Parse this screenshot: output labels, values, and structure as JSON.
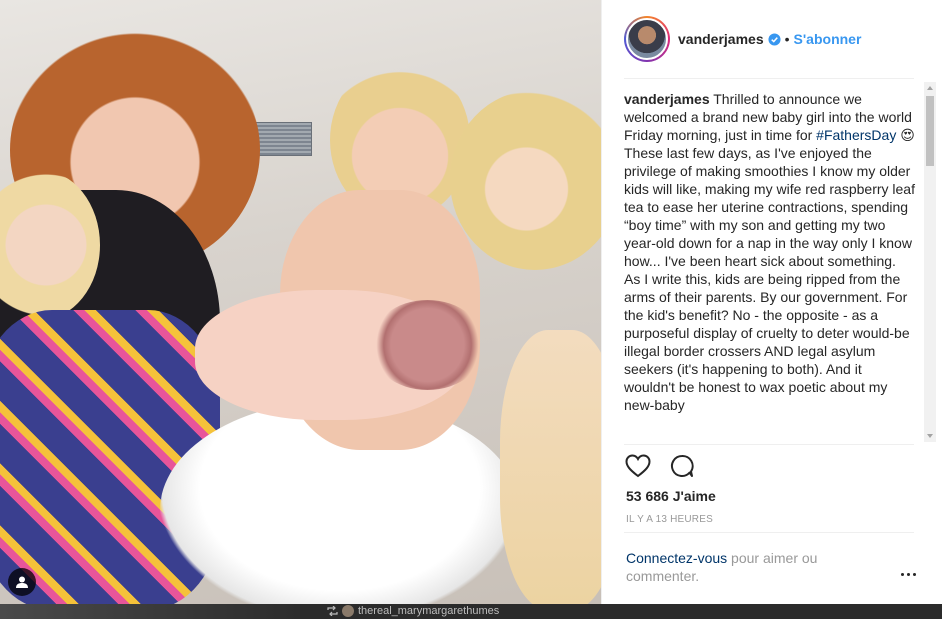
{
  "header": {
    "username": "vanderjames",
    "separator": "•",
    "follow_label": "S'abonner"
  },
  "caption": {
    "username": "vanderjames",
    "p1_before": "Thrilled to announce we welcomed a brand new baby girl into the world Friday morning, just in time for ",
    "hashtag": "#FathersDay",
    "emoji": "😍",
    "p2": "These last few days, as I've enjoyed the privilege of making smoothies I know my older kids will like, making my wife red raspberry leaf tea to ease her uterine contractions, spending “boy time” with my son and getting my two year-old down for a nap in the way only I know how... I've been heart sick about something.",
    "p3": "As I write this, kids are being ripped from the arms of their parents. By our government. For the kid's benefit? No - the opposite - as a purposeful display of cruelty to deter would-be illegal border crossers AND legal asylum seekers (it's happening to both). And it wouldn't be honest to wax poetic about my new-baby"
  },
  "likes": {
    "count": "53 686",
    "label": "J'aime"
  },
  "time_ago": "IL Y A 13 HEURES",
  "login": {
    "link": "Connectez-vous",
    "rest": " pour aimer ou commenter."
  },
  "below": {
    "repost_user": "thereal_marymargarethumes"
  },
  "colors": {
    "follow_blue": "#3897f0",
    "hashtag_navy": "#003569",
    "text": "#262626",
    "muted": "#999999"
  },
  "icons": {
    "verified": "verified-badge-icon",
    "like": "heart-icon",
    "comment": "comment-bubble-icon",
    "more": "more-options-icon",
    "user_tag": "user-tag-icon",
    "repost": "repost-icon"
  }
}
